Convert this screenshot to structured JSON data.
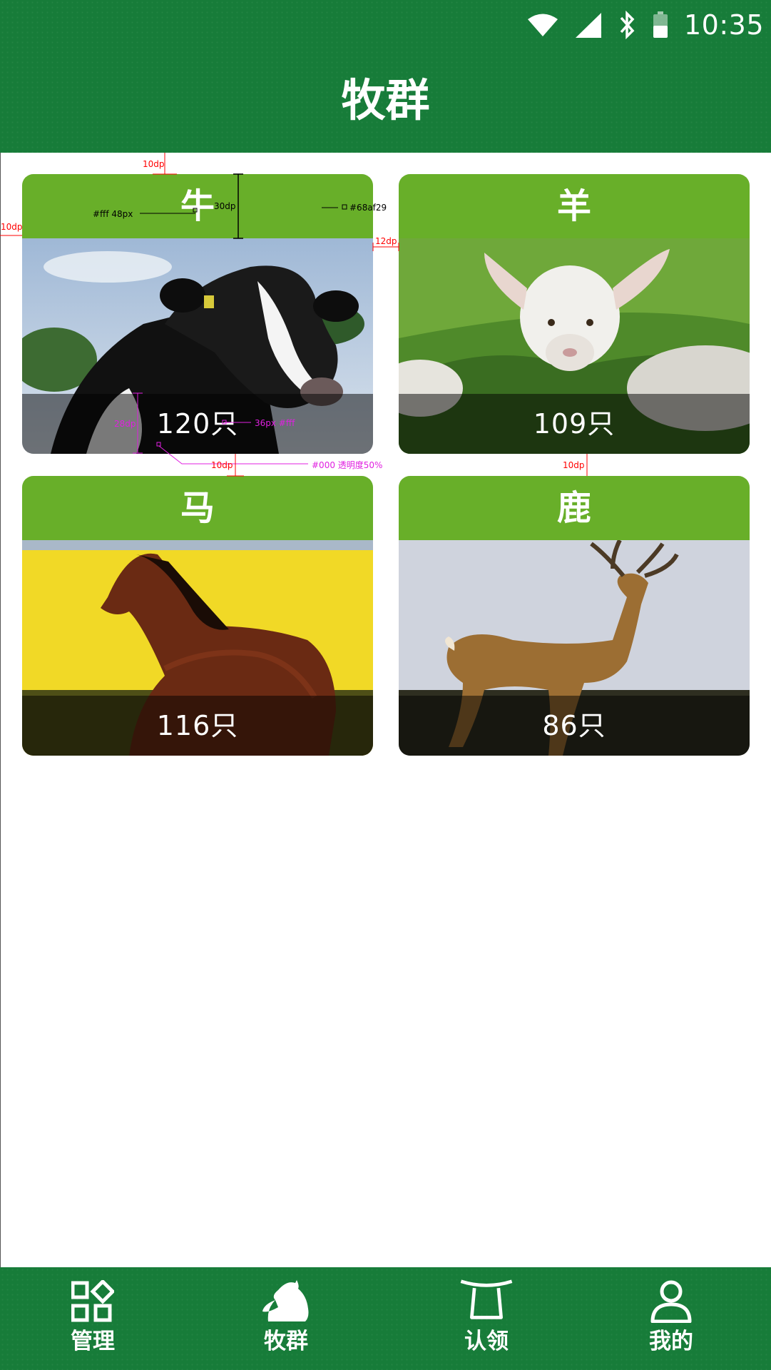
{
  "status_bar": {
    "time": "10:35",
    "icons": [
      "wifi-icon",
      "cell-signal-icon",
      "bluetooth-icon",
      "battery-icon"
    ]
  },
  "header": {
    "title": "牧群"
  },
  "colors": {
    "header_green": "#177c39",
    "card_head_green": "#68af29",
    "count_overlay": "#000000"
  },
  "cards": [
    {
      "name": "牛",
      "count": "120只",
      "photo": "cow-photo"
    },
    {
      "name": "羊",
      "count": "109只",
      "photo": "lamb-photo"
    },
    {
      "name": "马",
      "count": "116只",
      "photo": "horse-photo"
    },
    {
      "name": "鹿",
      "count": "86只",
      "photo": "deer-photo"
    }
  ],
  "annotations": {
    "gap_top": "10dp",
    "gap_left": "10dp",
    "head_font": "#fff  48px",
    "head_height": "30dp",
    "head_color": "#68af29",
    "gap_middle": "12dp",
    "count_height": "28dp",
    "count_font": "36px  #fff",
    "row_gap_left": "10dp",
    "overlay_note": "#000 透明度50%",
    "row_gap_right": "10dp"
  },
  "bottom_nav": [
    {
      "label": "管理",
      "icon": "grid-manage-icon"
    },
    {
      "label": "牧群",
      "icon": "horse-head-icon"
    },
    {
      "label": "认领",
      "icon": "claim-icon"
    },
    {
      "label": "我的",
      "icon": "person-icon"
    }
  ]
}
